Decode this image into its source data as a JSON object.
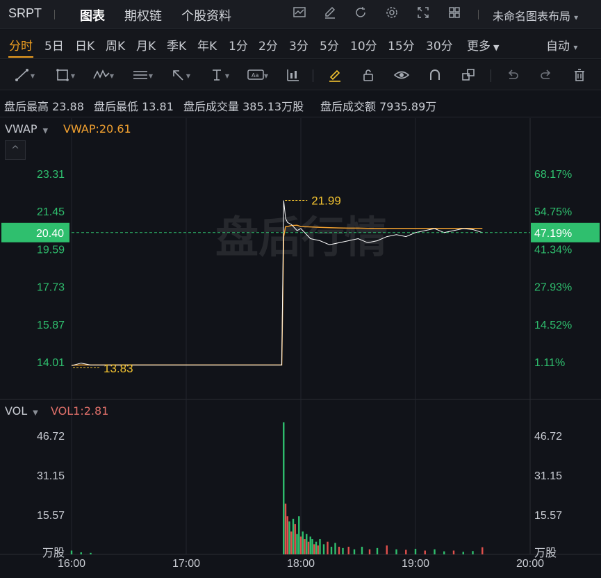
{
  "topbar": {
    "ticker": "SRPT",
    "tabs": [
      "图表",
      "期权链",
      "个股资料"
    ],
    "active_tab": 0,
    "icons": [
      "chart-icon",
      "edit-icon",
      "refresh-icon",
      "settings-icon",
      "fullscreen-icon",
      "grid-layout-icon"
    ],
    "layout_name": "未命名图表布局",
    "layout_caret": "▾"
  },
  "intervals": {
    "items": [
      "分时",
      "5日",
      "日K",
      "周K",
      "月K",
      "季K",
      "年K",
      "1分",
      "2分",
      "3分",
      "5分",
      "10分",
      "15分",
      "30分",
      "更多"
    ],
    "active": 0,
    "more_caret": "▼",
    "auto": "自动",
    "auto_caret": "▾"
  },
  "drawing_tools": [
    "line-tool-icon",
    "rectangle-tool-icon",
    "pattern-tool-icon",
    "fibonacci-tool-icon",
    "arrow-tool-icon",
    "text-tool-icon",
    "annotation-tool-icon",
    "measure-tool-icon",
    "highlighter-icon",
    "lock-icon",
    "visibility-icon",
    "magnet-icon",
    "group-icon",
    "undo-icon",
    "redo-icon",
    "trash-icon"
  ],
  "info": {
    "high_label": "盘后最高",
    "high": "23.88",
    "low_label": "盘后最低",
    "low": "13.81",
    "vol_label": "盘后成交量",
    "vol": "385.13万股",
    "amt_label": "盘后成交额",
    "amt": "7935.89万"
  },
  "price_panel": {
    "indicator": "VWAP",
    "indicator_value": "VWAP:20.61",
    "watermark": "盘后行情",
    "left_ticks": [
      "23.31",
      "21.45",
      "19.59",
      "17.73",
      "15.87",
      "14.01"
    ],
    "right_ticks": [
      "68.17%",
      "54.75%",
      "41.34%",
      "27.93%",
      "14.52%",
      "1.11%"
    ],
    "current_price": "20.40",
    "current_pct": "47.19%",
    "max_label": "21.99",
    "min_label": "13.83",
    "collapse_icon": "^"
  },
  "volume_panel": {
    "indicator": "VOL",
    "indicator_value": "VOL1:2.81",
    "left_ticks": [
      "46.72",
      "31.15",
      "15.57"
    ],
    "right_ticks": [
      "46.72",
      "31.15",
      "15.57"
    ],
    "unit": "万股"
  },
  "time_axis": [
    "16:00",
    "17:00",
    "18:00",
    "19:00",
    "20:00"
  ],
  "colors": {
    "up": "#2fbf6e",
    "down": "#e0504c",
    "price_line": "#ffffff",
    "vwap_line": "#f0a030",
    "accent": "#f0a020",
    "current_badge": "#2fbf6e",
    "max_label": "#f2c230"
  },
  "chart_data": {
    "type": "line",
    "price_series": {
      "name": "VWAP",
      "x": [
        "16:00",
        "16:05",
        "16:10",
        "16:15",
        "16:20",
        "16:25",
        "17:50",
        "17:51",
        "17:52",
        "17:53",
        "17:55",
        "17:58",
        "18:00",
        "18:05",
        "18:10",
        "18:15",
        "18:20",
        "18:25",
        "18:30",
        "18:35",
        "18:40",
        "18:45",
        "18:50",
        "18:55",
        "19:00",
        "19:05",
        "19:10",
        "19:15",
        "19:20",
        "19:25",
        "19:30",
        "19:35"
      ],
      "vwap": [
        13.85,
        13.86,
        13.86,
        13.86,
        13.86,
        13.86,
        13.86,
        20.2,
        20.7,
        20.7,
        20.75,
        20.76,
        20.7,
        20.68,
        20.66,
        20.64,
        20.63,
        20.62,
        20.62,
        20.61,
        20.61,
        20.61,
        20.61,
        20.61,
        20.61,
        20.61,
        20.61,
        20.61,
        20.61,
        20.61,
        20.61,
        20.61
      ],
      "price": [
        13.83,
        13.95,
        13.86,
        13.86,
        13.86,
        13.86,
        13.86,
        21.99,
        21.1,
        20.9,
        20.8,
        20.5,
        20.6,
        20.1,
        20.0,
        19.8,
        19.9,
        20.0,
        20.1,
        19.9,
        20.0,
        20.2,
        20.3,
        20.2,
        20.4,
        20.5,
        20.6,
        20.4,
        20.5,
        20.6,
        20.55,
        20.4
      ]
    },
    "volume": {
      "unit": "万股",
      "bars": [
        {
          "t": "17:51",
          "v": 52.0,
          "dir": "up"
        },
        {
          "t": "17:52",
          "v": 20.0,
          "dir": "down"
        },
        {
          "t": "17:53",
          "v": 15.0,
          "dir": "down"
        },
        {
          "t": "17:54",
          "v": 13.0,
          "dir": "up"
        },
        {
          "t": "17:55",
          "v": 9.0,
          "dir": "down"
        },
        {
          "t": "17:56",
          "v": 14.0,
          "dir": "up"
        },
        {
          "t": "17:57",
          "v": 12.0,
          "dir": "down"
        },
        {
          "t": "17:58",
          "v": 8.0,
          "dir": "up"
        },
        {
          "t": "17:59",
          "v": 15.0,
          "dir": "up"
        },
        {
          "t": "18:00",
          "v": 7.0,
          "dir": "down"
        },
        {
          "t": "18:01",
          "v": 9.0,
          "dir": "up"
        },
        {
          "t": "18:02",
          "v": 6.0,
          "dir": "down"
        },
        {
          "t": "18:03",
          "v": 8.0,
          "dir": "up"
        },
        {
          "t": "18:04",
          "v": 5.0,
          "dir": "down"
        },
        {
          "t": "18:05",
          "v": 7.0,
          "dir": "up"
        },
        {
          "t": "18:06",
          "v": 6.0,
          "dir": "up"
        },
        {
          "t": "18:07",
          "v": 4.0,
          "dir": "down"
        },
        {
          "t": "18:08",
          "v": 5.0,
          "dir": "up"
        },
        {
          "t": "18:09",
          "v": 3.5,
          "dir": "down"
        },
        {
          "t": "18:10",
          "v": 6.0,
          "dir": "up"
        },
        {
          "t": "18:12",
          "v": 4.0,
          "dir": "up"
        },
        {
          "t": "18:14",
          "v": 5.0,
          "dir": "down"
        },
        {
          "t": "18:16",
          "v": 3.0,
          "dir": "up"
        },
        {
          "t": "18:18",
          "v": 4.5,
          "dir": "up"
        },
        {
          "t": "18:20",
          "v": 3.0,
          "dir": "down"
        },
        {
          "t": "18:22",
          "v": 2.5,
          "dir": "up"
        },
        {
          "t": "18:25",
          "v": 3.0,
          "dir": "down"
        },
        {
          "t": "18:28",
          "v": 2.0,
          "dir": "up"
        },
        {
          "t": "18:32",
          "v": 3.0,
          "dir": "up"
        },
        {
          "t": "18:36",
          "v": 2.0,
          "dir": "down"
        },
        {
          "t": "18:40",
          "v": 2.5,
          "dir": "up"
        },
        {
          "t": "18:45",
          "v": 3.5,
          "dir": "down"
        },
        {
          "t": "18:50",
          "v": 2.0,
          "dir": "up"
        },
        {
          "t": "18:55",
          "v": 1.8,
          "dir": "down"
        },
        {
          "t": "19:00",
          "v": 2.2,
          "dir": "up"
        },
        {
          "t": "19:05",
          "v": 1.5,
          "dir": "down"
        },
        {
          "t": "19:10",
          "v": 2.0,
          "dir": "up"
        },
        {
          "t": "19:15",
          "v": 1.2,
          "dir": "up"
        },
        {
          "t": "19:20",
          "v": 1.5,
          "dir": "down"
        },
        {
          "t": "19:25",
          "v": 1.0,
          "dir": "up"
        },
        {
          "t": "19:30",
          "v": 1.3,
          "dir": "up"
        },
        {
          "t": "19:35",
          "v": 2.81,
          "dir": "down"
        },
        {
          "t": "16:00",
          "v": 1.5,
          "dir": "up"
        },
        {
          "t": "16:05",
          "v": 0.8,
          "dir": "up"
        },
        {
          "t": "16:10",
          "v": 0.6,
          "dir": "up"
        }
      ]
    },
    "price_range": [
      13.5,
      24.0
    ],
    "volume_range": [
      0,
      58
    ],
    "time_range": [
      "16:00",
      "20:00"
    ]
  }
}
